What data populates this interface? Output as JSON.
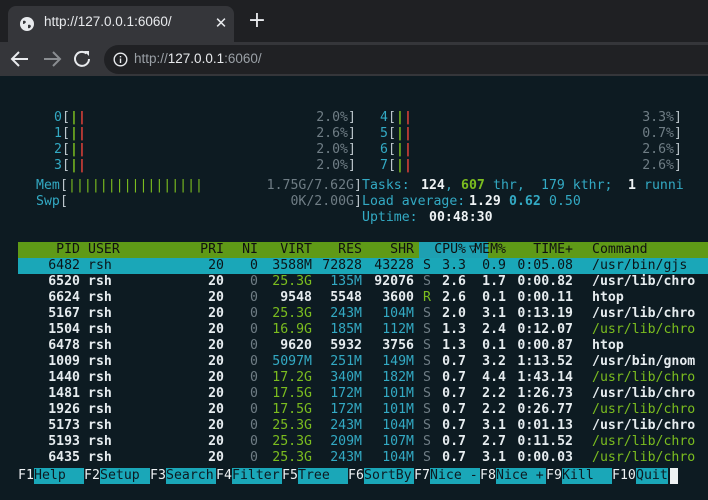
{
  "browser": {
    "tab_title": "http://127.0.0.1:6060/",
    "url_host": "127.0.0.1",
    "url_scheme": "http://",
    "url_port_path": ":6060/"
  },
  "htop": {
    "cpus": [
      {
        "id": "0",
        "pct": "2.0%"
      },
      {
        "id": "1",
        "pct": "2.6%"
      },
      {
        "id": "2",
        "pct": "2.0%"
      },
      {
        "id": "3",
        "pct": "2.0%"
      },
      {
        "id": "4",
        "pct": "3.3%"
      },
      {
        "id": "5",
        "pct": "0.7%"
      },
      {
        "id": "6",
        "pct": "2.6%"
      },
      {
        "id": "7",
        "pct": "2.6%"
      }
    ],
    "mem": {
      "label": "Mem",
      "value": "1.75G/7.62G"
    },
    "swp": {
      "label": "Swp",
      "value": "0K/2.00G"
    },
    "tasks": {
      "label": "Tasks:",
      "count": "124",
      "thr": "607",
      "thr_label": "thr,",
      "kthr": "179 kthr;",
      "running": "1",
      "running_label": "runni"
    },
    "load": {
      "label": "Load average:",
      "l1": "1.29",
      "l5": "0.62",
      "l15": "0.50"
    },
    "uptime": {
      "label": "Uptime:",
      "value": "00:48:30"
    },
    "columns": {
      "pid": "PID",
      "user": "USER",
      "pri": "PRI",
      "ni": "NI",
      "virt": "VIRT",
      "res": "RES",
      "shr": "SHR",
      "s": "S",
      "cpu": "CPU%",
      "sort_arrow": "▽",
      "mem": "MEM%",
      "time": "TIME+",
      "cmd": "Command"
    },
    "processes": [
      {
        "pid": "6482",
        "user": "rsh",
        "pri": "20",
        "ni": "0",
        "virt": "3588M",
        "res": "72828",
        "shr": "43228",
        "s": "S",
        "cpu": "3.3",
        "mem": "0.9",
        "time": "0:05.08",
        "cmd": "/usr/bin/gjs"
      },
      {
        "pid": "6520",
        "user": "rsh",
        "pri": "20",
        "ni": "0",
        "virt": "25.3G",
        "res": "135M",
        "shr": "92076",
        "s": "S",
        "cpu": "2.6",
        "mem": "1.7",
        "time": "0:00.82",
        "cmd": "/usr/lib/chro"
      },
      {
        "pid": "6624",
        "user": "rsh",
        "pri": "20",
        "ni": "0",
        "virt": "9548",
        "res": "5548",
        "shr": "3600",
        "s": "R",
        "cpu": "2.6",
        "mem": "0.1",
        "time": "0:00.11",
        "cmd": "htop"
      },
      {
        "pid": "5167",
        "user": "rsh",
        "pri": "20",
        "ni": "0",
        "virt": "25.3G",
        "res": "243M",
        "shr": "104M",
        "s": "S",
        "cpu": "2.0",
        "mem": "3.1",
        "time": "0:13.19",
        "cmd": "/usr/lib/chro"
      },
      {
        "pid": "1504",
        "user": "rsh",
        "pri": "20",
        "ni": "0",
        "virt": "16.9G",
        "res": "185M",
        "shr": "112M",
        "s": "S",
        "cpu": "1.3",
        "mem": "2.4",
        "time": "0:12.07",
        "cmd": "/usr/lib/chro"
      },
      {
        "pid": "6478",
        "user": "rsh",
        "pri": "20",
        "ni": "0",
        "virt": "9620",
        "res": "5932",
        "shr": "3756",
        "s": "S",
        "cpu": "1.3",
        "mem": "0.1",
        "time": "0:00.87",
        "cmd": "htop"
      },
      {
        "pid": "1009",
        "user": "rsh",
        "pri": "20",
        "ni": "0",
        "virt": "5097M",
        "res": "251M",
        "shr": "149M",
        "s": "S",
        "cpu": "0.7",
        "mem": "3.2",
        "time": "1:13.52",
        "cmd": "/usr/bin/gnom"
      },
      {
        "pid": "1440",
        "user": "rsh",
        "pri": "20",
        "ni": "0",
        "virt": "17.2G",
        "res": "340M",
        "shr": "182M",
        "s": "S",
        "cpu": "0.7",
        "mem": "4.4",
        "time": "1:43.14",
        "cmd": "/usr/lib/chro"
      },
      {
        "pid": "1481",
        "user": "rsh",
        "pri": "20",
        "ni": "0",
        "virt": "17.5G",
        "res": "172M",
        "shr": "101M",
        "s": "S",
        "cpu": "0.7",
        "mem": "2.2",
        "time": "1:26.73",
        "cmd": "/usr/lib/chro"
      },
      {
        "pid": "1926",
        "user": "rsh",
        "pri": "20",
        "ni": "0",
        "virt": "17.5G",
        "res": "172M",
        "shr": "101M",
        "s": "S",
        "cpu": "0.7",
        "mem": "2.2",
        "time": "0:26.77",
        "cmd": "/usr/lib/chro"
      },
      {
        "pid": "5173",
        "user": "rsh",
        "pri": "20",
        "ni": "0",
        "virt": "25.3G",
        "res": "243M",
        "shr": "104M",
        "s": "S",
        "cpu": "0.7",
        "mem": "3.1",
        "time": "0:01.13",
        "cmd": "/usr/lib/chro"
      },
      {
        "pid": "5193",
        "user": "rsh",
        "pri": "20",
        "ni": "0",
        "virt": "25.3G",
        "res": "209M",
        "shr": "107M",
        "s": "S",
        "cpu": "0.7",
        "mem": "2.7",
        "time": "0:11.52",
        "cmd": "/usr/lib/chro"
      },
      {
        "pid": "6435",
        "user": "rsh",
        "pri": "20",
        "ni": "0",
        "virt": "25.3G",
        "res": "243M",
        "shr": "104M",
        "s": "S",
        "cpu": "0.7",
        "mem": "3.1",
        "time": "0:00.03",
        "cmd": "/usr/lib/chro"
      }
    ],
    "fkeys": [
      {
        "key": "F1",
        "label": "Help  "
      },
      {
        "key": "F2",
        "label": "Setup "
      },
      {
        "key": "F3",
        "label": "Search"
      },
      {
        "key": "F4",
        "label": "Filter"
      },
      {
        "key": "F5",
        "label": "Tree  "
      },
      {
        "key": "F6",
        "label": "SortBy"
      },
      {
        "key": "F7",
        "label": "Nice -"
      },
      {
        "key": "F8",
        "label": "Nice +"
      },
      {
        "key": "F9",
        "label": "Kill  "
      },
      {
        "key": "F10",
        "label": "Quit"
      }
    ]
  },
  "colors": {
    "terminal_bg": "#0d1b22",
    "header_bg": "#5f9a17",
    "selected_bg": "#1aa7b8",
    "meter_green": "#7bbd1f",
    "meter_red": "#e2413a",
    "accent_cyan": "#33aac4"
  }
}
